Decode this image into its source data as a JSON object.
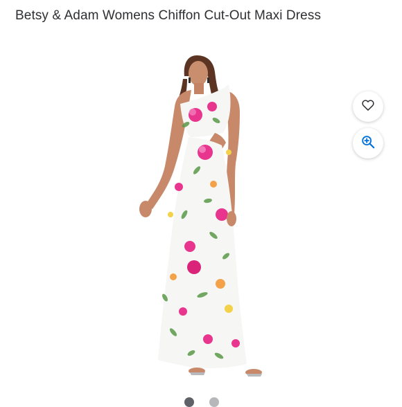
{
  "product": {
    "title": "Betsy & Adam Womens Chiffon Cut-Out Maxi Dress"
  },
  "actions": {
    "favorite_icon": "heart-outline-icon",
    "zoom_icon": "zoom-in-icon",
    "accent_color": "#0071dc"
  },
  "carousel": {
    "dot_count": 2,
    "active_index": 0
  },
  "colors": {
    "text": "#2e2f32",
    "dress_base": "#f6f7f4",
    "floral_pink": "#e8368f",
    "floral_green": "#5a9a4a"
  }
}
